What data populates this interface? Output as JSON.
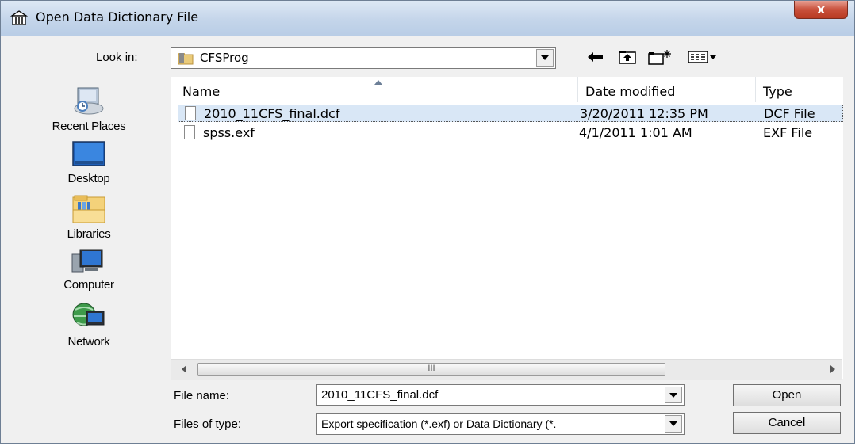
{
  "window": {
    "title": "Open Data Dictionary File",
    "close_glyph": "x"
  },
  "look_in": {
    "label": "Look in:",
    "value": "CFSProg"
  },
  "toolbar": [
    "back-arrow-icon",
    "up-folder-icon",
    "new-folder-icon",
    "view-menu-icon"
  ],
  "places": [
    {
      "label": "Recent Places",
      "icon": "recent-places-icon"
    },
    {
      "label": "Desktop",
      "icon": "desktop-icon"
    },
    {
      "label": "Libraries",
      "icon": "libraries-icon"
    },
    {
      "label": "Computer",
      "icon": "computer-icon"
    },
    {
      "label": "Network",
      "icon": "network-icon"
    }
  ],
  "columns": {
    "name": "Name",
    "date": "Date modified",
    "type": "Type"
  },
  "files": [
    {
      "name": "2010_11CFS_final.dcf",
      "date": "3/20/2011 12:35 PM",
      "type": "DCF File",
      "selected": true
    },
    {
      "name": "spss.exf",
      "date": "4/1/2011 1:01 AM",
      "type": "EXF File",
      "selected": false
    }
  ],
  "scrollbar": {
    "thumb_grip": "III"
  },
  "file_name": {
    "label": "File name:",
    "value": "2010_11CFS_final.dcf"
  },
  "file_type": {
    "label": "Files of type:",
    "value": "Export specification (*.exf) or Data Dictionary (*."
  },
  "buttons": {
    "open": "Open",
    "cancel": "Cancel"
  },
  "colors": {
    "selection": "#d9e7f6",
    "title_bar": "#c4d5ea",
    "close_button": "#c9503b"
  }
}
